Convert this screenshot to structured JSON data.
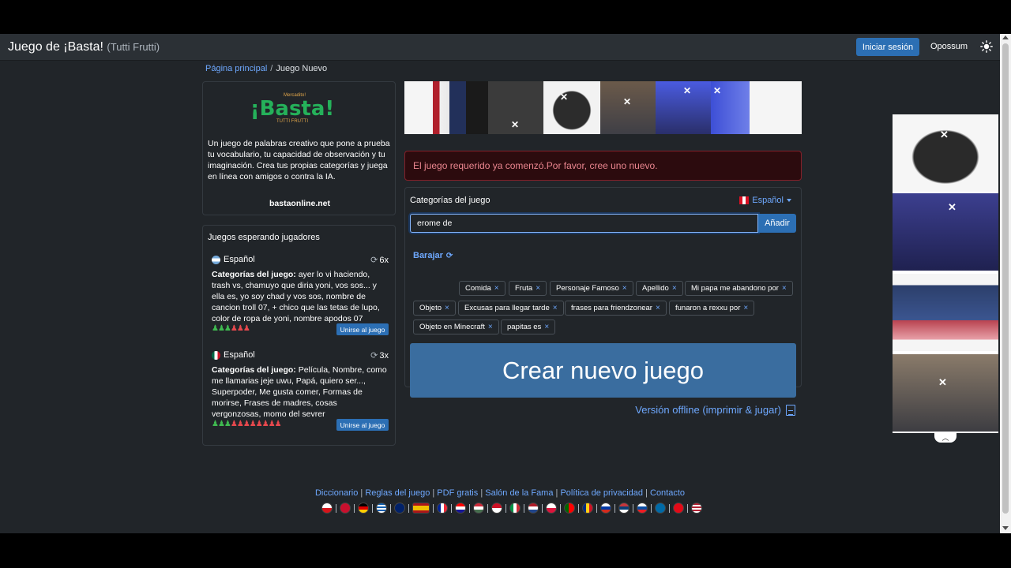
{
  "header": {
    "title": "Juego de ¡Basta!",
    "subtitle": "(Tutti Frutti)",
    "login_label": "Iniciar sesión",
    "username": "Opossum"
  },
  "breadcrumb": {
    "home": "Página principal",
    "separator": "/",
    "current": "Juego Nuevo"
  },
  "intro": {
    "logo_small": "Mercadito!",
    "logo_big": "¡Basta!",
    "logo_tagline": "TUTTI FRUTTI",
    "text": "Un juego de palabras creativo que pone a prueba tu vocabulario, tu capacidad de observación y tu imaginación. Crea tus propias categorías y juega en línea con amigos o contra la IA.",
    "site": "bastaonline.net"
  },
  "waiting": {
    "title": "Juegos esperando jugadores",
    "cats_label": "Categorías del juego:",
    "games": [
      {
        "lang": "Español",
        "count": "6x",
        "categories": "ayer lo vi haciendo, trash vs, chamuyo que diria yoni, vos sos... y ella es, yo soy chad y vos sos, nombre de cancion troll 07, + chico que las tetas de lupo, color de ropa de yoni, nombre apodos 07",
        "players_on": 3,
        "players_off": 3,
        "join_label": "Unirse al juego"
      },
      {
        "lang": "Español",
        "count": "3x",
        "categories": "Película, Nombre, como me llamarias jeje uwu, Papá, quiero ser..., Superpoder, Me gusta comer, Formas de morirse, Frases de madres, cosas vergonzosas, momo del sevrer",
        "players_on": 3,
        "players_off": 8,
        "join_label": "Unirse al juego"
      }
    ]
  },
  "alert": {
    "message": "El juego requerido ya comenzó.Por favor, cree uno nuevo."
  },
  "creator": {
    "title": "Categorías del juego",
    "language": "Español",
    "input_value": "erome de",
    "add_label": "Añadir",
    "shuffle_label": "Barajar",
    "chips": [
      "Comida",
      "Fruta",
      "Personaje Famoso",
      "Apellido",
      "Mi papa me abandono por",
      "Objeto",
      "Excusas para llegar tarde",
      "frases para friendzonear",
      "funaron a rexxu por",
      "Objeto en Minecraft",
      "papitas es"
    ],
    "create_label": "Crear nuevo juego",
    "offline_label": "Versión offline (imprimir & jugar)"
  },
  "footer": {
    "links": [
      "Diccionario",
      "Reglas del juego",
      "PDF gratis",
      "Salón de la Fama",
      "Política de privacidad",
      "Contacto"
    ]
  },
  "colors": {
    "background": "#212529",
    "primary": "#2c6fb4",
    "link": "#6ea8fe",
    "alert_bg": "#2c0b0e",
    "alert_text": "#ea868f",
    "player_on": "#3fb950",
    "player_off": "#e5484d"
  }
}
